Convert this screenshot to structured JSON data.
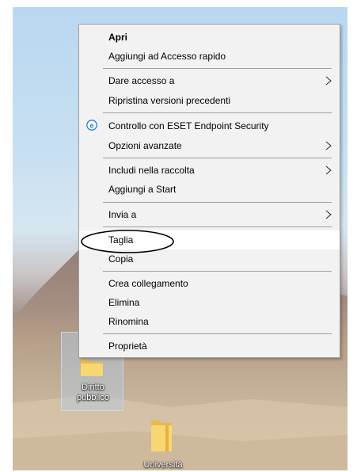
{
  "desktop": {
    "folders": [
      {
        "name": "Diritto\npubblico",
        "line1": "Diritto",
        "line2": "pubblico"
      },
      {
        "name": "Università"
      }
    ]
  },
  "context_menu": {
    "items": [
      {
        "label": "Apri",
        "bold": true
      },
      {
        "label": "Aggiungi ad Accesso rapido"
      },
      {
        "label": "Dare accesso a",
        "submenu": true
      },
      {
        "label": "Ripristina versioni precedenti"
      },
      {
        "label": "Controllo con ESET Endpoint Security",
        "icon": "eset-icon"
      },
      {
        "label": "Opzioni avanzate",
        "submenu": true
      },
      {
        "label": "Includi nella raccolta",
        "submenu": true
      },
      {
        "label": "Aggiungi a Start"
      },
      {
        "label": "Invia a",
        "submenu": true
      },
      {
        "label": "Taglia",
        "highlighted": true
      },
      {
        "label": "Copia"
      },
      {
        "label": "Crea collegamento"
      },
      {
        "label": "Elimina"
      },
      {
        "label": "Rinomina"
      },
      {
        "label": "Proprietà"
      }
    ]
  },
  "colors": {
    "menu_bg": "#f2f2f2",
    "separator": "#a0a0a0",
    "eset_accent": "#1e7fd6",
    "folder_yellow": "#f7d774"
  }
}
